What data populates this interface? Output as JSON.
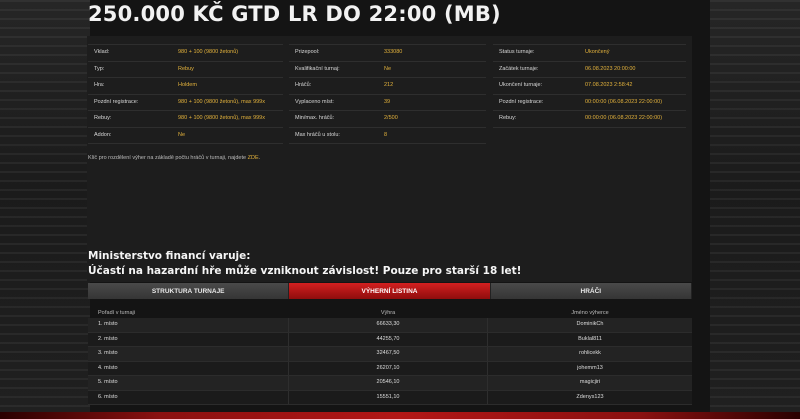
{
  "title": "250.000 KČ GTD LR DO 22:00 (MB)",
  "info_col1": [
    {
      "key": "Vklad:",
      "value": "980 + 100 (9800 žetonů)"
    },
    {
      "key": "Typ:",
      "value": "Rebuy"
    },
    {
      "key": "Hra:",
      "value": "Holdem"
    },
    {
      "key": "Pozdní registrace:",
      "value": "980 + 100 (9800 žetonů), max 999x"
    },
    {
      "key": "Rebuy:",
      "value": "980 + 100 (9800 žetonů), max 999x"
    },
    {
      "key": "Addon:",
      "value": "Ne"
    }
  ],
  "info_col2": [
    {
      "key": "Prizepool:",
      "value": "333080"
    },
    {
      "key": "Kvalifikační turnaj:",
      "value": "Ne"
    },
    {
      "key": "Hráčů:",
      "value": "212"
    },
    {
      "key": "Vyplaceno míst:",
      "value": "39"
    },
    {
      "key": "Min/max. hráčů:",
      "value": "2/500"
    },
    {
      "key": "Max hráčů u stolu:",
      "value": "8"
    }
  ],
  "info_col3": [
    {
      "key": "Status turnaje:",
      "value": "Ukončený"
    },
    {
      "key": "Začátek turnaje:",
      "value": "06.08.2023 20:00:00"
    },
    {
      "key": "Ukončení turnaje:",
      "value": "07.08.2023 2:58:42"
    },
    {
      "key": "Pozdní registrace:",
      "value": "00:00:00 (06.08.2023 22:00:00)"
    },
    {
      "key": "Rebuy:",
      "value": "00:00:00 (06.08.2023 22:00:00)"
    }
  ],
  "note": {
    "text": "Klíč pro rozdělení výher na základě počtu hráčů v turnaji, najdete",
    "link": "ZDE",
    "suffix": "."
  },
  "warning": {
    "line1": "Ministerstvo financí varuje:",
    "line2": "Účastí na hazardní hře může vzniknout závislost! Pouze pro starší 18 let!"
  },
  "tabs": [
    {
      "label": "STRUKTURA TURNAJE",
      "active": false
    },
    {
      "label": "VÝHERNÍ LISTINA",
      "active": true
    },
    {
      "label": "HRÁČI",
      "active": false
    }
  ],
  "results": {
    "headers": [
      "Pořadí v turnaji",
      "Výhra",
      "Jméno výherce"
    ],
    "rows": [
      [
        "1. místo",
        "66633,30",
        "DominikCh"
      ],
      [
        "2. místo",
        "44255,70",
        "Buklal811"
      ],
      [
        "3. místo",
        "32467,50",
        "rohlicekk"
      ],
      [
        "4. místo",
        "26207,10",
        "johemm13"
      ],
      [
        "5. místo",
        "20546,10",
        "magicjiri"
      ],
      [
        "6. místo",
        "15551,10",
        "Zdenys123"
      ]
    ]
  }
}
